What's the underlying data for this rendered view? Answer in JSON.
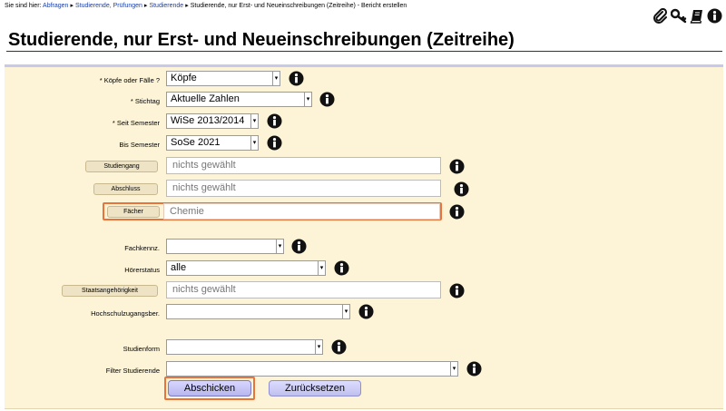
{
  "breadcrumb": {
    "prefix": "Sie sind hier:",
    "items": [
      "Abfragen",
      "Studierende, Prüfungen",
      "Studierende"
    ],
    "current": "Studierende, nur Erst- und Neueinschreibungen (Zeitreihe) - Bericht erstellen"
  },
  "toolbar": {
    "icons": [
      "paperclip-icon",
      "key-icon",
      "book-icon",
      "info-icon"
    ]
  },
  "page_title": "Studierende, nur Erst- und Neueinschreibungen (Zeitreihe)",
  "fields": {
    "koepfe": {
      "label": "* Köpfe oder Fälle ?",
      "value": "Köpfe"
    },
    "stichtag": {
      "label": "* Stichtag",
      "value": "Aktuelle Zahlen"
    },
    "seit_semester": {
      "label": "* Seit Semester",
      "value": "WiSe 2013/2014"
    },
    "bis_semester": {
      "label": "Bis Semester",
      "value": "SoSe 2021"
    },
    "studiengang": {
      "button": "Studiengang",
      "value": "nichts gewählt"
    },
    "abschluss": {
      "button": "Abschluss",
      "value": "nichts gewählt"
    },
    "faecher": {
      "button": "Fächer",
      "value": "Chemie"
    },
    "fachkennz": {
      "label": "Fachkennz.",
      "value": ""
    },
    "hoererstatus": {
      "label": "Hörerstatus",
      "value": "alle"
    },
    "staatsangehoerigkeit": {
      "button": "Staatsangehörigkeit",
      "value": "nichts gewählt"
    },
    "hochschulzugangsber": {
      "label": "Hochschulzugangsber.",
      "value": ""
    },
    "studienform": {
      "label": "Studienform",
      "value": ""
    },
    "filter_studierende": {
      "label": "Filter Studierende",
      "value": ""
    }
  },
  "actions": {
    "submit": "Abschicken",
    "reset": "Zurücksetzen"
  },
  "colors": {
    "panel_background": "#fdf3d6",
    "highlight": "#e8743c",
    "link": "#1a3fa6"
  }
}
